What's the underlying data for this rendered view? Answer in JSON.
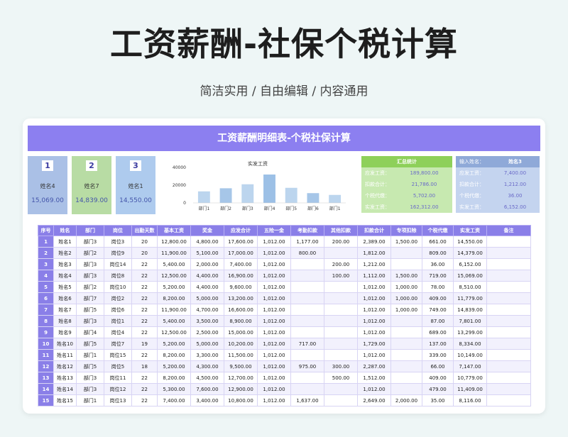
{
  "header": {
    "title": "工资薪酬-社保个税计算",
    "subtitle": "简洁实用 / 自由编辑 / 内容通用"
  },
  "sheet": {
    "banner": "工资薪酬明细表-个税社保计算"
  },
  "employee_cards": [
    {
      "num": "1",
      "name": "姓名4",
      "value": "15,069.00",
      "bg": "#aac0e6"
    },
    {
      "num": "2",
      "name": "姓名7",
      "value": "14,839.00",
      "bg": "#b8dca4"
    },
    {
      "num": "3",
      "name": "姓名1",
      "value": "14,550.00",
      "bg": "#aecbee"
    }
  ],
  "chart_data": {
    "type": "bar",
    "title": "实发工资",
    "categories": [
      "部门1",
      "部门2",
      "部门3",
      "部门4",
      "部门5",
      "部门6",
      "部门1"
    ],
    "values": [
      13000,
      16500,
      21000,
      32000,
      17000,
      11000,
      9000
    ],
    "ylim": [
      0,
      40000
    ],
    "yticks": [
      0,
      20000,
      40000
    ],
    "ytick_labels": [
      "0",
      "20000",
      "40000"
    ],
    "grid": false,
    "colors": [
      "#bcd5ee",
      "#a6c6e8",
      "#bcd5ee",
      "#9cc0e6",
      "#bcd5ee",
      "#a6c6e8",
      "#bcd5ee"
    ]
  },
  "summary": {
    "header": "汇总统计",
    "header_bg": "#8ed05a",
    "row_bg": "#c7e9b0",
    "rows": [
      {
        "label": "应发工资：",
        "value": "189,800.00"
      },
      {
        "label": "扣款合计：",
        "value": "21,786.00"
      },
      {
        "label": "个税代缴：",
        "value": "5,702.00"
      },
      {
        "label": "实发工资：",
        "value": "162,312.00"
      }
    ]
  },
  "lookup": {
    "label": "输入姓名：",
    "name": "姓名3",
    "header_bg": "#8fa9d8",
    "row_bg": "#c4d4ef",
    "rows": [
      {
        "label": "应发工资：",
        "value": "7,400.00"
      },
      {
        "label": "扣款合计：",
        "value": "1,212.00"
      },
      {
        "label": "个税代缴：",
        "value": "36.00"
      },
      {
        "label": "实发工资：",
        "value": "6,152.00"
      }
    ]
  },
  "table": {
    "columns": [
      "序号",
      "姓名",
      "部门",
      "岗位",
      "出勤天数",
      "基本工资",
      "奖金",
      "应发合计",
      "五险一金",
      "考勤扣款",
      "其他扣款",
      "扣款合计",
      "专项扣除",
      "个税代缴",
      "实发工资",
      "备注"
    ],
    "rows": [
      [
        "1",
        "姓名1",
        "部门3",
        "岗位3",
        "20",
        "12,800.00",
        "4,800.00",
        "17,600.00",
        "1,012.00",
        "1,177.00",
        "200.00",
        "2,389.00",
        "1,500.00",
        "661.00",
        "14,550.00",
        ""
      ],
      [
        "2",
        "姓名2",
        "部门2",
        "岗位9",
        "20",
        "11,900.00",
        "5,100.00",
        "17,000.00",
        "1,012.00",
        "800.00",
        "",
        "1,812.00",
        "",
        "809.00",
        "14,379.00",
        ""
      ],
      [
        "3",
        "姓名3",
        "部门3",
        "岗位14",
        "22",
        "5,400.00",
        "2,000.00",
        "7,400.00",
        "1,012.00",
        "",
        "200.00",
        "1,212.00",
        "",
        "36.00",
        "6,152.00",
        ""
      ],
      [
        "4",
        "姓名4",
        "部门3",
        "岗位8",
        "22",
        "12,500.00",
        "4,400.00",
        "16,900.00",
        "1,012.00",
        "",
        "100.00",
        "1,112.00",
        "1,500.00",
        "719.00",
        "15,069.00",
        ""
      ],
      [
        "5",
        "姓名5",
        "部门2",
        "岗位10",
        "22",
        "5,200.00",
        "4,400.00",
        "9,600.00",
        "1,012.00",
        "",
        "",
        "1,012.00",
        "1,000.00",
        "78.00",
        "8,510.00",
        ""
      ],
      [
        "6",
        "姓名6",
        "部门7",
        "岗位2",
        "22",
        "8,200.00",
        "5,000.00",
        "13,200.00",
        "1,012.00",
        "",
        "",
        "1,012.00",
        "1,000.00",
        "409.00",
        "11,779.00",
        ""
      ],
      [
        "7",
        "姓名7",
        "部门5",
        "岗位6",
        "22",
        "11,900.00",
        "4,700.00",
        "16,600.00",
        "1,012.00",
        "",
        "",
        "1,012.00",
        "1,000.00",
        "749.00",
        "14,839.00",
        ""
      ],
      [
        "8",
        "姓名8",
        "部门3",
        "岗位1",
        "22",
        "5,400.00",
        "3,500.00",
        "8,900.00",
        "1,012.00",
        "",
        "",
        "1,012.00",
        "",
        "87.00",
        "7,801.00",
        ""
      ],
      [
        "9",
        "姓名9",
        "部门4",
        "岗位4",
        "22",
        "12,500.00",
        "2,500.00",
        "15,000.00",
        "1,012.00",
        "",
        "",
        "1,012.00",
        "",
        "689.00",
        "13,299.00",
        ""
      ],
      [
        "10",
        "姓名10",
        "部门5",
        "岗位7",
        "19",
        "5,200.00",
        "5,000.00",
        "10,200.00",
        "1,012.00",
        "717.00",
        "",
        "1,729.00",
        "",
        "137.00",
        "8,334.00",
        ""
      ],
      [
        "11",
        "姓名11",
        "部门1",
        "岗位15",
        "22",
        "8,200.00",
        "3,300.00",
        "11,500.00",
        "1,012.00",
        "",
        "",
        "1,012.00",
        "",
        "339.00",
        "10,149.00",
        ""
      ],
      [
        "12",
        "姓名12",
        "部门5",
        "岗位5",
        "18",
        "5,200.00",
        "4,300.00",
        "9,500.00",
        "1,012.00",
        "975.00",
        "300.00",
        "2,287.00",
        "",
        "66.00",
        "7,147.00",
        ""
      ],
      [
        "13",
        "姓名13",
        "部门3",
        "岗位11",
        "22",
        "8,200.00",
        "4,500.00",
        "12,700.00",
        "1,012.00",
        "",
        "500.00",
        "1,512.00",
        "",
        "409.00",
        "10,779.00",
        ""
      ],
      [
        "14",
        "姓名14",
        "部门3",
        "岗位12",
        "22",
        "5,300.00",
        "7,600.00",
        "12,900.00",
        "1,012.00",
        "",
        "",
        "1,012.00",
        "",
        "479.00",
        "11,409.00",
        ""
      ],
      [
        "15",
        "姓名15",
        "部门1",
        "岗位13",
        "22",
        "7,400.00",
        "3,400.00",
        "10,800.00",
        "1,012.00",
        "1,637.00",
        "",
        "2,649.00",
        "2,000.00",
        "35.00",
        "8,116.00",
        ""
      ]
    ]
  }
}
